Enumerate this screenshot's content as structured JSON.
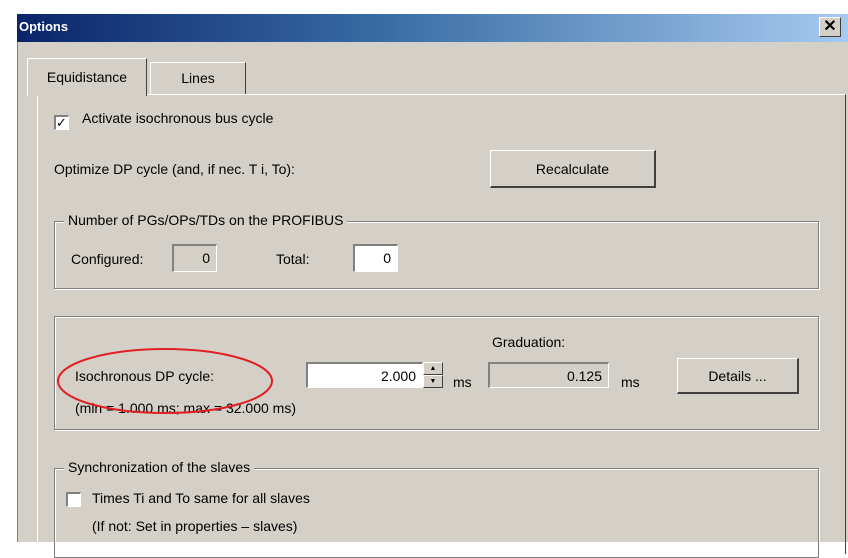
{
  "window": {
    "title": "Options",
    "close_glyph": "✕"
  },
  "tabs": [
    {
      "label": "Equidistance",
      "active": true
    },
    {
      "label": "Lines",
      "active": false
    }
  ],
  "activate": {
    "label": "Activate isochronous bus cycle",
    "checked": true,
    "check_glyph": "✓"
  },
  "optimize": {
    "label": "Optimize DP cycle (and, if nec. T i, To):",
    "button": "Recalculate"
  },
  "pg_group": {
    "legend": "Number of PGs/OPs/TDs on the PROFIBUS",
    "configured_label": "Configured:",
    "configured_value": "0",
    "total_label": "Total:",
    "total_value": "0"
  },
  "cycle_group": {
    "graduation_label": "Graduation:",
    "cycle_label": "Isochronous DP cycle:",
    "cycle_value": "2.000",
    "cycle_unit": "ms",
    "graduation_value": "0.125",
    "graduation_unit": "ms",
    "details_button": "Details ...",
    "range_text": "(min = 1.000 ms; max = 32.000 ms)",
    "annotation_color": "#e02020"
  },
  "sync_group": {
    "legend": "Synchronization of the slaves",
    "times_label": "Times Ti and To same for all slaves",
    "times_checked": false,
    "note": "(If not: Set in properties – slaves)"
  },
  "icons": {
    "spin_up": "▲",
    "spin_down": "▼"
  }
}
